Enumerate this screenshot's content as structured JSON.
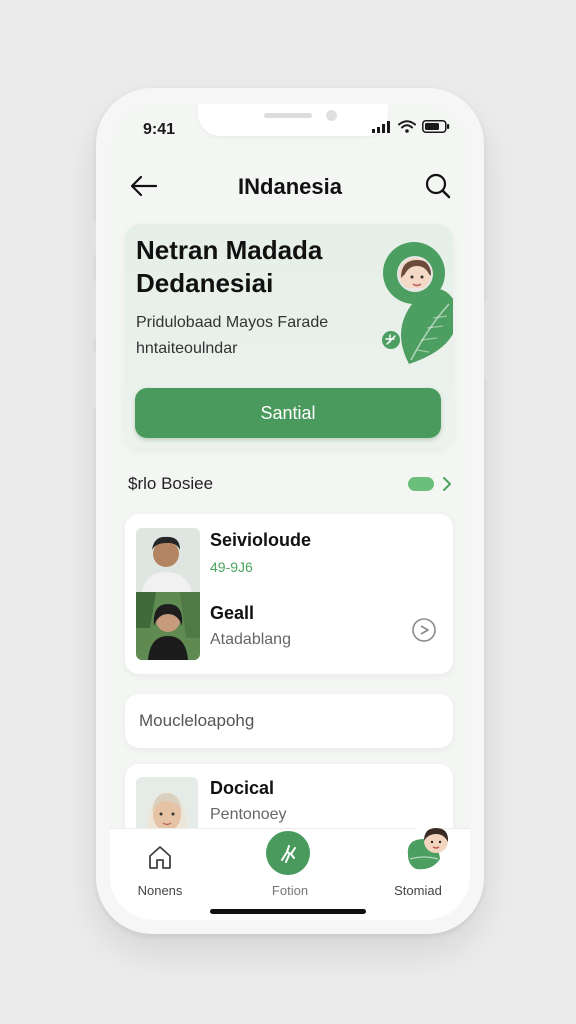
{
  "status": {
    "time": "9:41"
  },
  "header": {
    "title": "INdanesia",
    "back_icon": "arrow-left-icon",
    "search_icon": "search-icon"
  },
  "hero": {
    "title_line1": "Netran Madada",
    "title_line2": "Dedanesiai",
    "subtitle_line1": "Pridulobaad  Mayos Farade",
    "subtitle_line2": "hntaiteoulndar",
    "cta_label": "Santial",
    "accent": "#4a9a5d"
  },
  "section": {
    "title": "$rlo Bosiee"
  },
  "card": {
    "row1_title": "Seivioloude",
    "row1_meta": "49-9J6",
    "row2_title": "Geall",
    "row2_sub": "Atadablang"
  },
  "input": {
    "text": "Moucleloapohg"
  },
  "peek": {
    "title": "Docical",
    "sub": "Pentonoey"
  },
  "tabs": {
    "home_label": "Nonens",
    "center_label": "Fotion",
    "right_label": "Stomiad"
  }
}
